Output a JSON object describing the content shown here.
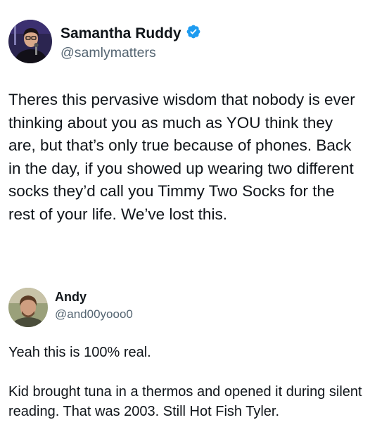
{
  "tweet": {
    "display_name": "Samantha Ruddy",
    "handle": "@samlymatters",
    "verified": true,
    "text": "Theres this pervasive wisdom that nobody is ever thinking about you as much as YOU think they are, but that’s only true because of phones. Back in the day, if you showed up wearing two different socks they’d call you Timmy Two Socks for the rest of your life. We’ve lost this."
  },
  "reply": {
    "display_name": "Andy",
    "handle": "@and00yooo0",
    "paragraphs": [
      "Yeah this is 100% real.",
      "Kid brought tuna in a thermos and opened it during silent reading. That was 2003. Still Hot Fish Tyler."
    ]
  },
  "colors": {
    "text": "#0f1419",
    "secondary": "#536471",
    "verified_badge": "#1d9bf0"
  },
  "icons": {
    "verified": "verified-badge-icon"
  }
}
